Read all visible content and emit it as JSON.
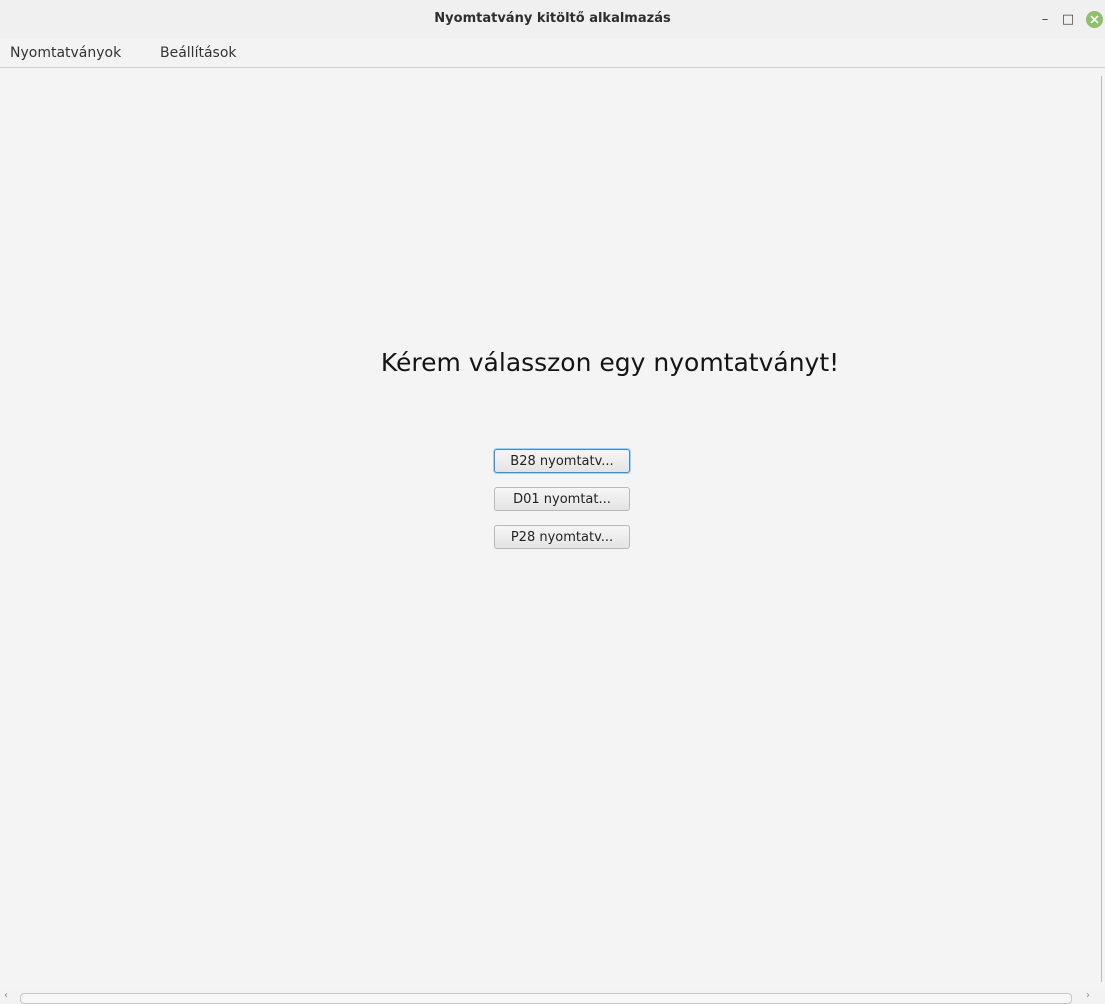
{
  "window": {
    "title": "Nyomtatvány kitöltő alkalmazás",
    "controls": {
      "minimize_icon": "–",
      "maximize_icon": "□",
      "close_icon": "×"
    }
  },
  "menubar": {
    "items": [
      {
        "label": "Nyomtatványok"
      },
      {
        "label": "Beállítások"
      }
    ]
  },
  "main": {
    "heading": "Kérem válasszon egy nyomtatványt!",
    "buttons": [
      {
        "label": "B28 nyomtatv...",
        "focused": true
      },
      {
        "label": "D01 nyomtat...",
        "focused": false
      },
      {
        "label": "P28 nyomtatv...",
        "focused": false
      }
    ]
  },
  "scrollbar": {
    "left_arrow": "‹",
    "right_arrow": "›"
  },
  "colors": {
    "background": "#f3f3f3",
    "focus_border": "#3a8fd6",
    "close_button": "#8fbf6a"
  }
}
